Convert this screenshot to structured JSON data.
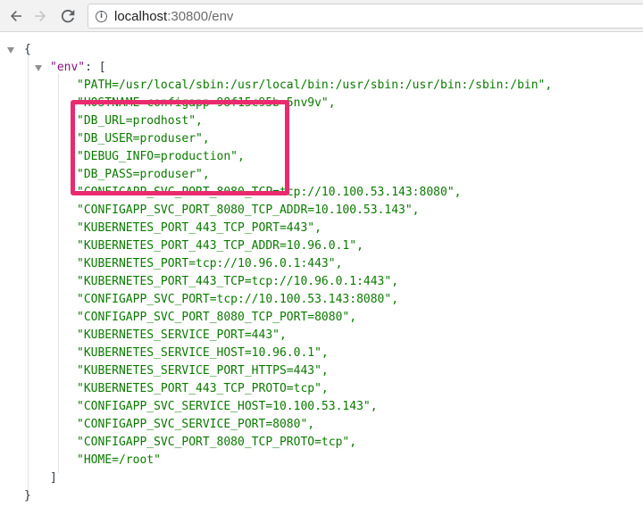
{
  "browser": {
    "url_host": "localhost",
    "url_rest": ":30800/env",
    "icons": [
      "back-arrow-icon",
      "forward-arrow-icon",
      "reload-icon",
      "info-icon"
    ]
  },
  "json_view": {
    "open_brace": "{",
    "close_brace": "}",
    "env_key": "\"env\"",
    "env_sep": ": [",
    "close_bracket": "]",
    "entries": [
      "\"PATH=/usr/local/sbin:/usr/local/bin:/usr/sbin:/usr/bin:/sbin:/bin\",",
      "\"HOSTNAME=configapp-98f15c95b-5nv9v\",",
      "\"DB_URL=prodhost\",",
      "\"DB_USER=produser\",",
      "\"DEBUG_INFO=production\",",
      "\"DB_PASS=produser\",",
      "\"CONFIGAPP_SVC_PORT_8080_TCP=tcp://10.100.53.143:8080\",",
      "\"CONFIGAPP_SVC_PORT_8080_TCP_ADDR=10.100.53.143\",",
      "\"KUBERNETES_PORT_443_TCP_PORT=443\",",
      "\"KUBERNETES_PORT_443_TCP_ADDR=10.96.0.1\",",
      "\"KUBERNETES_PORT=tcp://10.96.0.1:443\",",
      "\"KUBERNETES_PORT_443_TCP=tcp://10.96.0.1:443\",",
      "\"CONFIGAPP_SVC_PORT=tcp://10.100.53.143:8080\",",
      "\"CONFIGAPP_SVC_PORT_8080_TCP_PORT=8080\",",
      "\"KUBERNETES_SERVICE_PORT=443\",",
      "\"KUBERNETES_SERVICE_HOST=10.96.0.1\",",
      "\"KUBERNETES_SERVICE_PORT_HTTPS=443\",",
      "\"KUBERNETES_PORT_443_TCP_PROTO=tcp\",",
      "\"CONFIGAPP_SVC_SERVICE_HOST=10.100.53.143\",",
      "\"CONFIGAPP_SVC_SERVICE_PORT=8080\",",
      "\"CONFIGAPP_SVC_PORT_8080_TCP_PROTO=tcp\",",
      "\"HOME=/root\""
    ]
  },
  "colors": {
    "string": "#0b7a00",
    "key": "#881280",
    "highlight": "#ea2a6e"
  }
}
